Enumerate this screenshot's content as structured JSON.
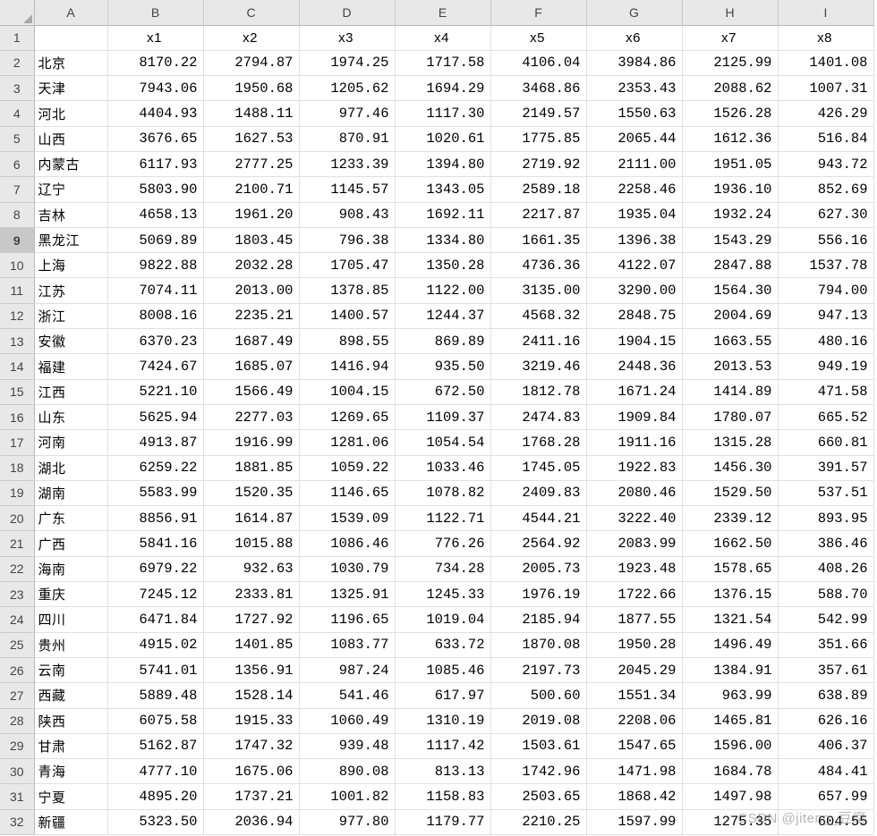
{
  "columns": [
    "A",
    "B",
    "C",
    "D",
    "E",
    "F",
    "G",
    "H",
    "I"
  ],
  "header_row": [
    "",
    "x1",
    "x2",
    "x3",
    "x4",
    "x5",
    "x6",
    "x7",
    "x8"
  ],
  "selected_row_index": 9,
  "watermark": "CSDN @jiteng_豆腐",
  "rows": [
    {
      "label": "北京",
      "v": [
        "8170.22",
        "2794.87",
        "1974.25",
        "1717.58",
        "4106.04",
        "3984.86",
        "2125.99",
        "1401.08"
      ]
    },
    {
      "label": "天津",
      "v": [
        "7943.06",
        "1950.68",
        "1205.62",
        "1694.29",
        "3468.86",
        "2353.43",
        "2088.62",
        "1007.31"
      ]
    },
    {
      "label": "河北",
      "v": [
        "4404.93",
        "1488.11",
        "977.46",
        "1117.30",
        "2149.57",
        "1550.63",
        "1526.28",
        "426.29"
      ]
    },
    {
      "label": "山西",
      "v": [
        "3676.65",
        "1627.53",
        "870.91",
        "1020.61",
        "1775.85",
        "2065.44",
        "1612.36",
        "516.84"
      ]
    },
    {
      "label": "内蒙古",
      "v": [
        "6117.93",
        "2777.25",
        "1233.39",
        "1394.80",
        "2719.92",
        "2111.00",
        "1951.05",
        "943.72"
      ]
    },
    {
      "label": "辽宁",
      "v": [
        "5803.90",
        "2100.71",
        "1145.57",
        "1343.05",
        "2589.18",
        "2258.46",
        "1936.10",
        "852.69"
      ]
    },
    {
      "label": "吉林",
      "v": [
        "4658.13",
        "1961.20",
        "908.43",
        "1692.11",
        "2217.87",
        "1935.04",
        "1932.24",
        "627.30"
      ]
    },
    {
      "label": "黑龙江",
      "v": [
        "5069.89",
        "1803.45",
        "796.38",
        "1334.80",
        "1661.35",
        "1396.38",
        "1543.29",
        "556.16"
      ]
    },
    {
      "label": "上海",
      "v": [
        "9822.88",
        "2032.28",
        "1705.47",
        "1350.28",
        "4736.36",
        "4122.07",
        "2847.88",
        "1537.78"
      ]
    },
    {
      "label": "江苏",
      "v": [
        "7074.11",
        "2013.00",
        "1378.85",
        "1122.00",
        "3135.00",
        "3290.00",
        "1564.30",
        "794.00"
      ]
    },
    {
      "label": "浙江",
      "v": [
        "8008.16",
        "2235.21",
        "1400.57",
        "1244.37",
        "4568.32",
        "2848.75",
        "2004.69",
        "947.13"
      ]
    },
    {
      "label": "安徽",
      "v": [
        "6370.23",
        "1687.49",
        "898.55",
        "869.89",
        "2411.16",
        "1904.15",
        "1663.55",
        "480.16"
      ]
    },
    {
      "label": "福建",
      "v": [
        "7424.67",
        "1685.07",
        "1416.94",
        "935.50",
        "3219.46",
        "2448.36",
        "2013.53",
        "949.19"
      ]
    },
    {
      "label": "江西",
      "v": [
        "5221.10",
        "1566.49",
        "1004.15",
        "672.50",
        "1812.78",
        "1671.24",
        "1414.89",
        "471.58"
      ]
    },
    {
      "label": "山东",
      "v": [
        "5625.94",
        "2277.03",
        "1269.65",
        "1109.37",
        "2474.83",
        "1909.84",
        "1780.07",
        "665.52"
      ]
    },
    {
      "label": "河南",
      "v": [
        "4913.87",
        "1916.99",
        "1281.06",
        "1054.54",
        "1768.28",
        "1911.16",
        "1315.28",
        "660.81"
      ]
    },
    {
      "label": "湖北",
      "v": [
        "6259.22",
        "1881.85",
        "1059.22",
        "1033.46",
        "1745.05",
        "1922.83",
        "1456.30",
        "391.57"
      ]
    },
    {
      "label": "湖南",
      "v": [
        "5583.99",
        "1520.35",
        "1146.65",
        "1078.82",
        "2409.83",
        "2080.46",
        "1529.50",
        "537.51"
      ]
    },
    {
      "label": "广东",
      "v": [
        "8856.91",
        "1614.87",
        "1539.09",
        "1122.71",
        "4544.21",
        "3222.40",
        "2339.12",
        "893.95"
      ]
    },
    {
      "label": "广西",
      "v": [
        "5841.16",
        "1015.88",
        "1086.46",
        "776.26",
        "2564.92",
        "2083.99",
        "1662.50",
        "386.46"
      ]
    },
    {
      "label": "海南",
      "v": [
        "6979.22",
        "932.63",
        "1030.79",
        "734.28",
        "2005.73",
        "1923.48",
        "1578.65",
        "408.26"
      ]
    },
    {
      "label": "重庆",
      "v": [
        "7245.12",
        "2333.81",
        "1325.91",
        "1245.33",
        "1976.19",
        "1722.66",
        "1376.15",
        "588.70"
      ]
    },
    {
      "label": "四川",
      "v": [
        "6471.84",
        "1727.92",
        "1196.65",
        "1019.04",
        "2185.94",
        "1877.55",
        "1321.54",
        "542.99"
      ]
    },
    {
      "label": "贵州",
      "v": [
        "4915.02",
        "1401.85",
        "1083.77",
        "633.72",
        "1870.08",
        "1950.28",
        "1496.49",
        "351.66"
      ]
    },
    {
      "label": "云南",
      "v": [
        "5741.01",
        "1356.91",
        "987.24",
        "1085.46",
        "2197.73",
        "2045.29",
        "1384.91",
        "357.61"
      ]
    },
    {
      "label": "西藏",
      "v": [
        "5889.48",
        "1528.14",
        "541.46",
        "617.97",
        "500.60",
        "1551.34",
        "963.99",
        "638.89"
      ]
    },
    {
      "label": "陕西",
      "v": [
        "6075.58",
        "1915.33",
        "1060.49",
        "1310.19",
        "2019.08",
        "2208.06",
        "1465.81",
        "626.16"
      ]
    },
    {
      "label": "甘肃",
      "v": [
        "5162.87",
        "1747.32",
        "939.48",
        "1117.42",
        "1503.61",
        "1547.65",
        "1596.00",
        "406.37"
      ]
    },
    {
      "label": "青海",
      "v": [
        "4777.10",
        "1675.06",
        "890.08",
        "813.13",
        "1742.96",
        "1471.98",
        "1684.78",
        "484.41"
      ]
    },
    {
      "label": "宁夏",
      "v": [
        "4895.20",
        "1737.21",
        "1001.82",
        "1158.83",
        "2503.65",
        "1868.42",
        "1497.98",
        "657.99"
      ]
    },
    {
      "label": "新疆",
      "v": [
        "5323.50",
        "2036.94",
        "977.80",
        "1179.77",
        "2210.25",
        "1597.99",
        "1275.35",
        "604.55"
      ]
    }
  ]
}
